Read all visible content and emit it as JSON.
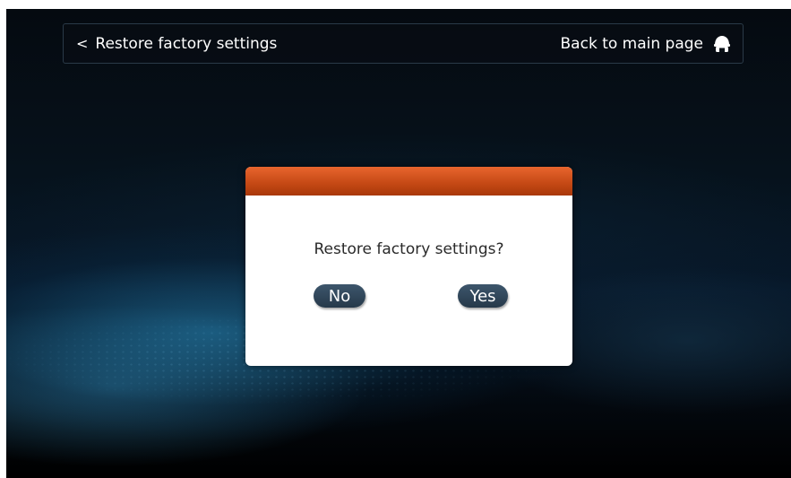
{
  "topbar": {
    "back_label": "Restore factory settings",
    "back_icon": "chevron-left-icon",
    "main_page_label": "Back to main page",
    "main_page_icon": "home-icon"
  },
  "dialog": {
    "message": "Restore factory settings?",
    "no_label": "No",
    "yes_label": "Yes",
    "header_color": "#d45a1e",
    "button_color": "#2f4559"
  }
}
